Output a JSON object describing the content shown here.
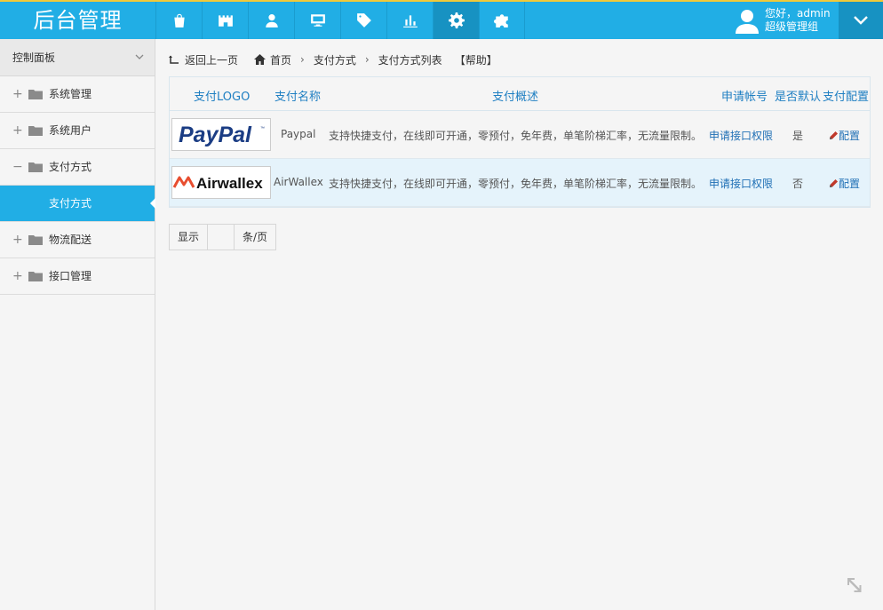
{
  "header": {
    "brand": "后台管理",
    "nav_icons": [
      "bag-icon",
      "castle-icon",
      "user-icon",
      "monitor-icon",
      "tag-icon",
      "chart-icon",
      "gear-icon",
      "puzzle-icon"
    ],
    "active_index": 6,
    "user_greeting": "您好，admin",
    "user_group": "超级管理组"
  },
  "sidebar": {
    "title": "控制面板",
    "items": [
      {
        "label": "系统管理",
        "toggle": "+"
      },
      {
        "label": "系统用户",
        "toggle": "+"
      },
      {
        "label": "支付方式",
        "toggle": "−"
      },
      {
        "label": "物流配送",
        "toggle": "+"
      },
      {
        "label": "接口管理",
        "toggle": "+"
      }
    ],
    "active_sub": "支付方式"
  },
  "breadcrumb": {
    "back": "返回上一页",
    "home": "首页",
    "level1": "支付方式",
    "level2": "支付方式列表",
    "help": "【帮助】"
  },
  "table": {
    "headers": {
      "logo": "支付LOGO",
      "name": "支付名称",
      "desc": "支付概述",
      "apply": "申请帐号",
      "default": "是否默认",
      "config": "支付配置"
    },
    "rows": [
      {
        "logo_text": "PayPal",
        "name": "Paypal",
        "desc": "支持快捷支付，在线即可开通，零预付，免年费，单笔阶梯汇率，无流量限制。",
        "apply": "申请接口权限",
        "default": "是",
        "config": "配置"
      },
      {
        "logo_text": "Airwallex",
        "name": "AirWallex",
        "desc": "支持快捷支付，在线即可开通，零预付，免年费，单笔阶梯汇率，无流量限制。",
        "apply": "申请接口权限",
        "default": "否",
        "config": "配置"
      }
    ]
  },
  "pager": {
    "show": "显示",
    "per_page": "条/页"
  },
  "colors": {
    "primary": "#21aee5",
    "accent_border": "#f0c93a",
    "link": "#1f6fb5",
    "airwallex_red": "#e84e30",
    "paypal_dark": "#1b3d84",
    "paypal_light": "#1d9be0"
  }
}
